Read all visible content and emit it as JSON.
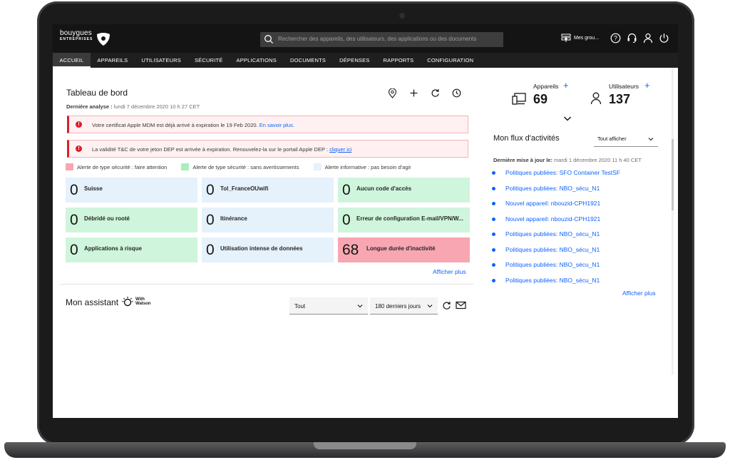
{
  "header": {
    "brand": "bouygues",
    "brand_sub": "ENTREPRISES",
    "search_placeholder": "Rechercher des appareils, des utilisateurs, des applications ou des documents",
    "groups_label": "Mes grou..."
  },
  "nav": {
    "items": [
      "ACCUEIL",
      "APPAREILS",
      "UTILISATEURS",
      "SÉCURITÉ",
      "APPLICATIONS",
      "DOCUMENTS",
      "DÉPENSES",
      "RAPPORTS",
      "CONFIGURATION"
    ],
    "active": "ACCUEIL"
  },
  "dashboard": {
    "title": "Tableau de bord",
    "last_scan_label": "Dernière analyse :",
    "last_scan_value": "lundi 7 décembre 2020 10 h 27 CET",
    "tools": [
      "location-icon",
      "plus-icon",
      "refresh-icon",
      "clock-icon"
    ],
    "alerts": [
      {
        "text": "Votre certificat Apple MDM est déjà arrivé à expiration le  19 Feb 2020.",
        "link": "En savoir plus."
      },
      {
        "text": "La validité T&C de votre jeton DEP est arrivée à expiration. Renouvelez-la sur le portail Apple DEP :",
        "link": "cliquer ici"
      }
    ],
    "legend": [
      {
        "label": "Alerte de type sécurité : faire attention",
        "color": "#f8a6b2"
      },
      {
        "label": "Alerte de type sécurité : sans avertissements",
        "color": "#a7f0ba"
      },
      {
        "label": "Alerte informative : pas besoin d'agir",
        "color": "#e5f1fb"
      }
    ],
    "tiles": [
      {
        "value": "0",
        "label": "Suisse",
        "level": "blue"
      },
      {
        "value": "0",
        "label": "Tol_FranceOUwifi",
        "level": "blue"
      },
      {
        "value": "0",
        "label": "Aucun code d'accès",
        "level": "green"
      },
      {
        "value": "0",
        "label": "Débridé ou rooté",
        "level": "green"
      },
      {
        "value": "0",
        "label": "Itinérance",
        "level": "blue"
      },
      {
        "value": "0",
        "label": "Erreur de configuration E-mail/VPN/W...",
        "level": "green"
      },
      {
        "value": "0",
        "label": "Applications à risque",
        "level": "green"
      },
      {
        "value": "0",
        "label": "Utilisation intense de données",
        "level": "blue"
      },
      {
        "value": "68",
        "label": "Longue durée d'inactivité",
        "level": "red"
      }
    ],
    "more_label": "Afficher plus"
  },
  "assistant": {
    "title": "Mon assistant",
    "watson_line1": "With",
    "watson_line2": "Watson",
    "filter_value": "Tout",
    "period_value": "180 derniers jours"
  },
  "kpis": {
    "devices_label": "Appareils",
    "devices_value": "69",
    "users_label": "Utilisateurs",
    "users_value": "137",
    "plus": "+"
  },
  "activity": {
    "title": "Mon flux d'activités",
    "filter_value": "Tout afficher",
    "updated_label": "Dernière mise à jour le:",
    "updated_value": "mardi 1 décembre 2020 11 h 40 CET",
    "items": [
      "Politiques publiées: SFO Container TestSF",
      "Politiques publiées: NBO_sécu_N1",
      "Nouvel appareil: nbouzid-CPH1921",
      "Nouvel appareil: nbouzid-CPH1921",
      "Politiques publiées: NBO_sécu_N1",
      "Politiques publiées: NBO_sécu_N1",
      "Politiques publiées: NBO_sécu_N1",
      "Politiques publiées: NBO_sécu_N1"
    ],
    "more_label": "Afficher plus"
  }
}
